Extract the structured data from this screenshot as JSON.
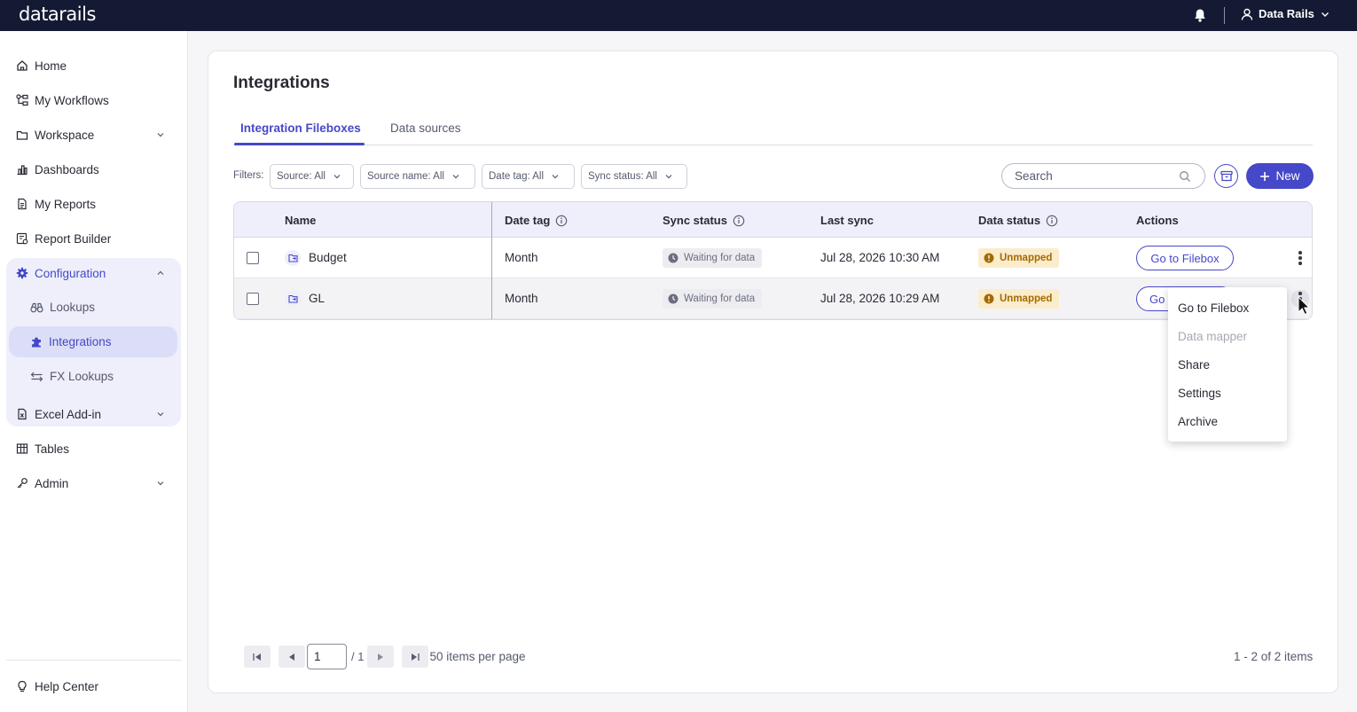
{
  "app": {
    "logo_text": "datarails",
    "user_name": "Data Rails"
  },
  "sidebar": {
    "items": [
      {
        "label": "Home",
        "icon": "home-icon"
      },
      {
        "label": "My Workflows",
        "icon": "workflow-icon"
      },
      {
        "label": "Workspace",
        "icon": "folder-icon",
        "expandable": true
      },
      {
        "label": "Dashboards",
        "icon": "chart-icon"
      },
      {
        "label": "My Reports",
        "icon": "document-icon"
      },
      {
        "label": "Report Builder",
        "icon": "report-builder-icon"
      },
      {
        "label": "Configuration",
        "icon": "gear-icon",
        "expanded": true
      },
      {
        "label": "Excel Add-in",
        "icon": "excel-icon",
        "expandable": true
      },
      {
        "label": "Tables",
        "icon": "table-icon"
      },
      {
        "label": "Admin",
        "icon": "key-icon",
        "expandable": true
      }
    ],
    "config_sub": [
      {
        "label": "Lookups",
        "icon": "binoculars-icon"
      },
      {
        "label": "Integrations",
        "icon": "puzzle-icon",
        "active": true
      },
      {
        "label": "FX Lookups",
        "icon": "exchange-icon"
      }
    ],
    "help": "Help Center"
  },
  "page": {
    "title": "Integrations",
    "tabs": [
      "Integration Fileboxes",
      "Data sources"
    ],
    "filters_label": "Filters:",
    "filters": [
      "Source: All",
      "Source name: All",
      "Date tag: All",
      "Sync status: All"
    ],
    "search_placeholder": "Search",
    "new_label": "New"
  },
  "table": {
    "columns": [
      "Name",
      "Date tag",
      "Sync status",
      "Last sync",
      "Data status",
      "Actions"
    ],
    "rows": [
      {
        "name": "Budget",
        "date_tag": "Month",
        "sync_status": "Waiting for data",
        "last_sync": "Jul 28, 2026 10:30 AM",
        "data_status": "Unmapped",
        "action": "Go to Filebox"
      },
      {
        "name": "GL",
        "date_tag": "Month",
        "sync_status": "Waiting for data",
        "last_sync": "Jul 28, 2026 10:29 AM",
        "data_status": "Unmapped",
        "action": "Go"
      }
    ]
  },
  "pager": {
    "page": "1",
    "total_pages": "/ 1",
    "per_page": "50 items per page",
    "summary": "1 - 2 of 2 items"
  },
  "menu": {
    "items": [
      {
        "label": "Go to Filebox",
        "disabled": false
      },
      {
        "label": "Data mapper",
        "disabled": true
      },
      {
        "label": "Share",
        "disabled": false
      },
      {
        "label": "Settings",
        "disabled": false
      },
      {
        "label": "Archive",
        "disabled": false
      }
    ]
  },
  "colors": {
    "accent": "#4548c8",
    "topbar": "#141a33",
    "warning_bg": "#fbeccc",
    "warning_fg": "#a36a00"
  }
}
